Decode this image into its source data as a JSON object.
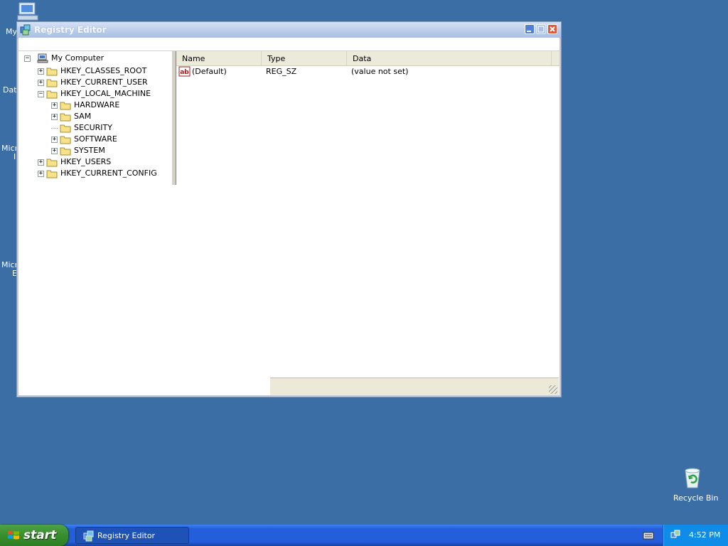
{
  "desktop": {
    "icons": [
      {
        "label": "My",
        "icon": "my-computer-icon"
      },
      {
        "label": "Dat",
        "icon": "data-icon"
      },
      {
        "label": "Micr",
        "label2": "I",
        "icon": "microsoft-icon"
      },
      {
        "label": "Micr",
        "label2": "E",
        "icon": "microsoft-icon"
      }
    ],
    "recycle_bin": {
      "label": "Recycle Bin",
      "icon": "recycle-bin-icon"
    }
  },
  "window": {
    "title": "Registry Editor",
    "title_icon": "registry-editor-icon",
    "controls": [
      "minimize-icon",
      "maximize-icon",
      "close-icon"
    ]
  },
  "tree": {
    "root": {
      "label": "My Computer",
      "icon": "computer-icon"
    },
    "nodes": [
      {
        "label": "HKEY_CLASSES_ROOT",
        "expander": "+",
        "level": 1
      },
      {
        "label": "HKEY_CURRENT_USER",
        "expander": "+",
        "level": 1
      },
      {
        "label": "HKEY_LOCAL_MACHINE",
        "expander": "-",
        "level": 1
      },
      {
        "label": "HARDWARE",
        "expander": "+",
        "level": 2
      },
      {
        "label": "SAM",
        "expander": "+",
        "level": 2
      },
      {
        "label": "SECURITY",
        "expander": "",
        "level": 2
      },
      {
        "label": "SOFTWARE",
        "expander": "+",
        "level": 2
      },
      {
        "label": "SYSTEM",
        "expander": "+",
        "level": 2
      },
      {
        "label": "HKEY_USERS",
        "expander": "+",
        "level": 1
      },
      {
        "label": "HKEY_CURRENT_CONFIG",
        "expander": "+",
        "level": 1
      }
    ],
    "collapse_glyph": "−"
  },
  "list": {
    "columns": [
      "Name",
      "Type",
      "Data"
    ],
    "rows": [
      {
        "icon": "string-value-icon",
        "icon_text": "ab",
        "name": "(Default)",
        "type": "REG_SZ",
        "data": "(value not set)"
      }
    ]
  },
  "taskbar": {
    "start_label": "start",
    "task_button": "Registry Editor",
    "clock": "4:52 PM"
  },
  "colors": {
    "desktop": "#3a6ea5",
    "taskbar": "#245edb",
    "start": "#388e2c",
    "tray": "#0f8ce8"
  }
}
